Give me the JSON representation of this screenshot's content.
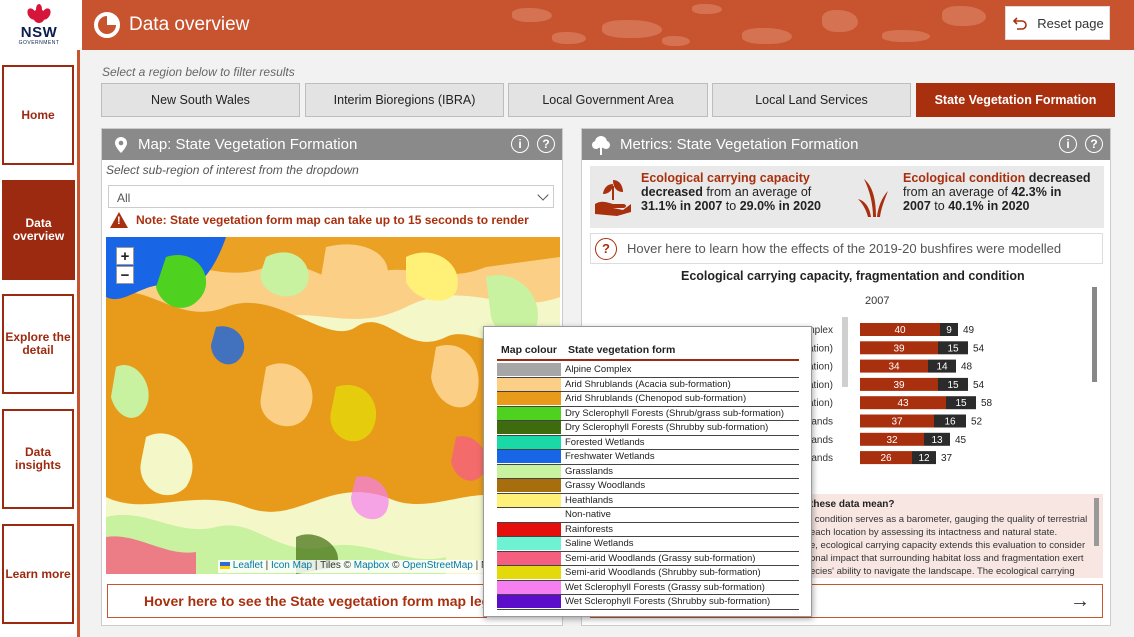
{
  "app": {
    "logo_text": "NSW",
    "logo_subtext": "GOVERNMENT",
    "title": "Data overview",
    "reset_label": "Reset page"
  },
  "sidebar": {
    "items": [
      {
        "label": "Home",
        "active": false
      },
      {
        "label": "Data overview",
        "active": true
      },
      {
        "label": "Explore the detail",
        "active": false
      },
      {
        "label": "Data insights",
        "active": false
      },
      {
        "label": "Learn more",
        "active": false
      }
    ]
  },
  "regions": {
    "prompt": "Select a region below to filter results",
    "tabs": [
      {
        "label": "New South Wales",
        "active": false
      },
      {
        "label": "Interim Bioregions (IBRA)",
        "active": false
      },
      {
        "label": "Local Government Area",
        "active": false
      },
      {
        "label": "Local Land Services",
        "active": false
      },
      {
        "label": "State Vegetation Formation",
        "active": true
      }
    ]
  },
  "map_panel": {
    "title": "Map: State Vegetation Formation",
    "sub_prompt": "Select sub-region of interest from the dropdown",
    "dropdown_value": "All",
    "warning": "Note: State vegetation form map can take up to 15 seconds to render",
    "zoom_in": "+",
    "zoom_out": "−",
    "attribution": {
      "leaflet": "Leaflet",
      "sep1": " | ",
      "iconmap": "Icon Map",
      "tiles": " | Tiles © ",
      "mapbox": "Mapbox",
      "copy": " © ",
      "osm": "OpenStreetMap",
      "tail": " | N"
    },
    "legend_prompt": "Hover here to see the State vegetation form map legend"
  },
  "legend": {
    "col_colour": "Map colour",
    "col_form": "State vegetation form",
    "items": [
      {
        "name": "Alpine Complex",
        "color": "#a6a6a6"
      },
      {
        "name": "Arid Shrublands (Acacia sub-formation)",
        "color": "#fbcf85"
      },
      {
        "name": "Arid Shrublands (Chenopod sub-formation)",
        "color": "#e89b1a"
      },
      {
        "name": "Dry Sclerophyll Forests (Shrub/grass sub-formation)",
        "color": "#4fd11f"
      },
      {
        "name": "Dry Sclerophyll Forests (Shrubby sub-formation)",
        "color": "#3d6b0d"
      },
      {
        "name": "Forested Wetlands",
        "color": "#19d9a6"
      },
      {
        "name": "Freshwater Wetlands",
        "color": "#1866e6"
      },
      {
        "name": "Grasslands",
        "color": "#c9f2a0"
      },
      {
        "name": "Grassy Woodlands",
        "color": "#a66e0d"
      },
      {
        "name": "Heathlands",
        "color": "#fff178"
      },
      {
        "name": "Non-native",
        "color": "#ffffff"
      },
      {
        "name": "Rainforests",
        "color": "#e60d0d"
      },
      {
        "name": "Saline Wetlands",
        "color": "#6ff2d2"
      },
      {
        "name": "Semi-arid Woodlands (Grassy sub-formation)",
        "color": "#f55f7f"
      },
      {
        "name": "Semi-arid Woodlands (Shrubby sub-formation)",
        "color": "#e3d90b"
      },
      {
        "name": "Wet Sclerophyll Forests (Grassy sub-formation)",
        "color": "#f57ff0"
      },
      {
        "name": "Wet Sclerophyll Forests (Shrubby sub-formation)",
        "color": "#5c0dc9"
      }
    ]
  },
  "metrics_panel": {
    "title": "Metrics: State Vegetation Formation",
    "capacity": {
      "line1_hl": "Ecological carrying capacity",
      "line2_bold": "decreased",
      "line2_rest": " from an average of",
      "line3": "31.1% in 2007",
      "line3_mid": " to ",
      "line3_end": "29.0% in 2020"
    },
    "condition": {
      "line1_hl": "Ecological condition",
      "line1_bold": " decreased",
      "line2_rest": "from an average of ",
      "line2_bold": "42.3% in",
      "line3": "2007",
      "line3_mid": " to ",
      "line3_end": "40.1% in 2020"
    },
    "bushfire_prompt": "Hover here to learn how the effects of the 2019-20 bushfires were modelled",
    "interp_heading": "these data mean?",
    "interp_lines": [
      "l condition serves as a barometer, gauging the quality of terrestrial",
      "each location by assessing its intactness and natural state.",
      "e, ecological carrying capacity extends this evaluation to consider",
      "onal impact that surrounding habitat loss and fragmentation exert",
      "ecies' ability to navigate the landscape. The ecological carrying"
    ]
  },
  "chart_data": {
    "type": "bar",
    "title": "Ecological carrying capacity, fragmentation and condition",
    "subtitle": "2007",
    "categories": [
      "mplex",
      "ation)",
      "ation)",
      "ation)",
      "ation)",
      "lands",
      "lands",
      "lands"
    ],
    "series": [
      {
        "name": "",
        "values": [
          40,
          39,
          34,
          39,
          43,
          37,
          32,
          26
        ],
        "color": "#a9300f"
      },
      {
        "name": "",
        "values": [
          9,
          15,
          14,
          15,
          15,
          16,
          13,
          12
        ],
        "color": "#2b2b2b"
      }
    ],
    "totals": [
      49,
      54,
      48,
      54,
      58,
      52,
      45,
      37
    ]
  }
}
